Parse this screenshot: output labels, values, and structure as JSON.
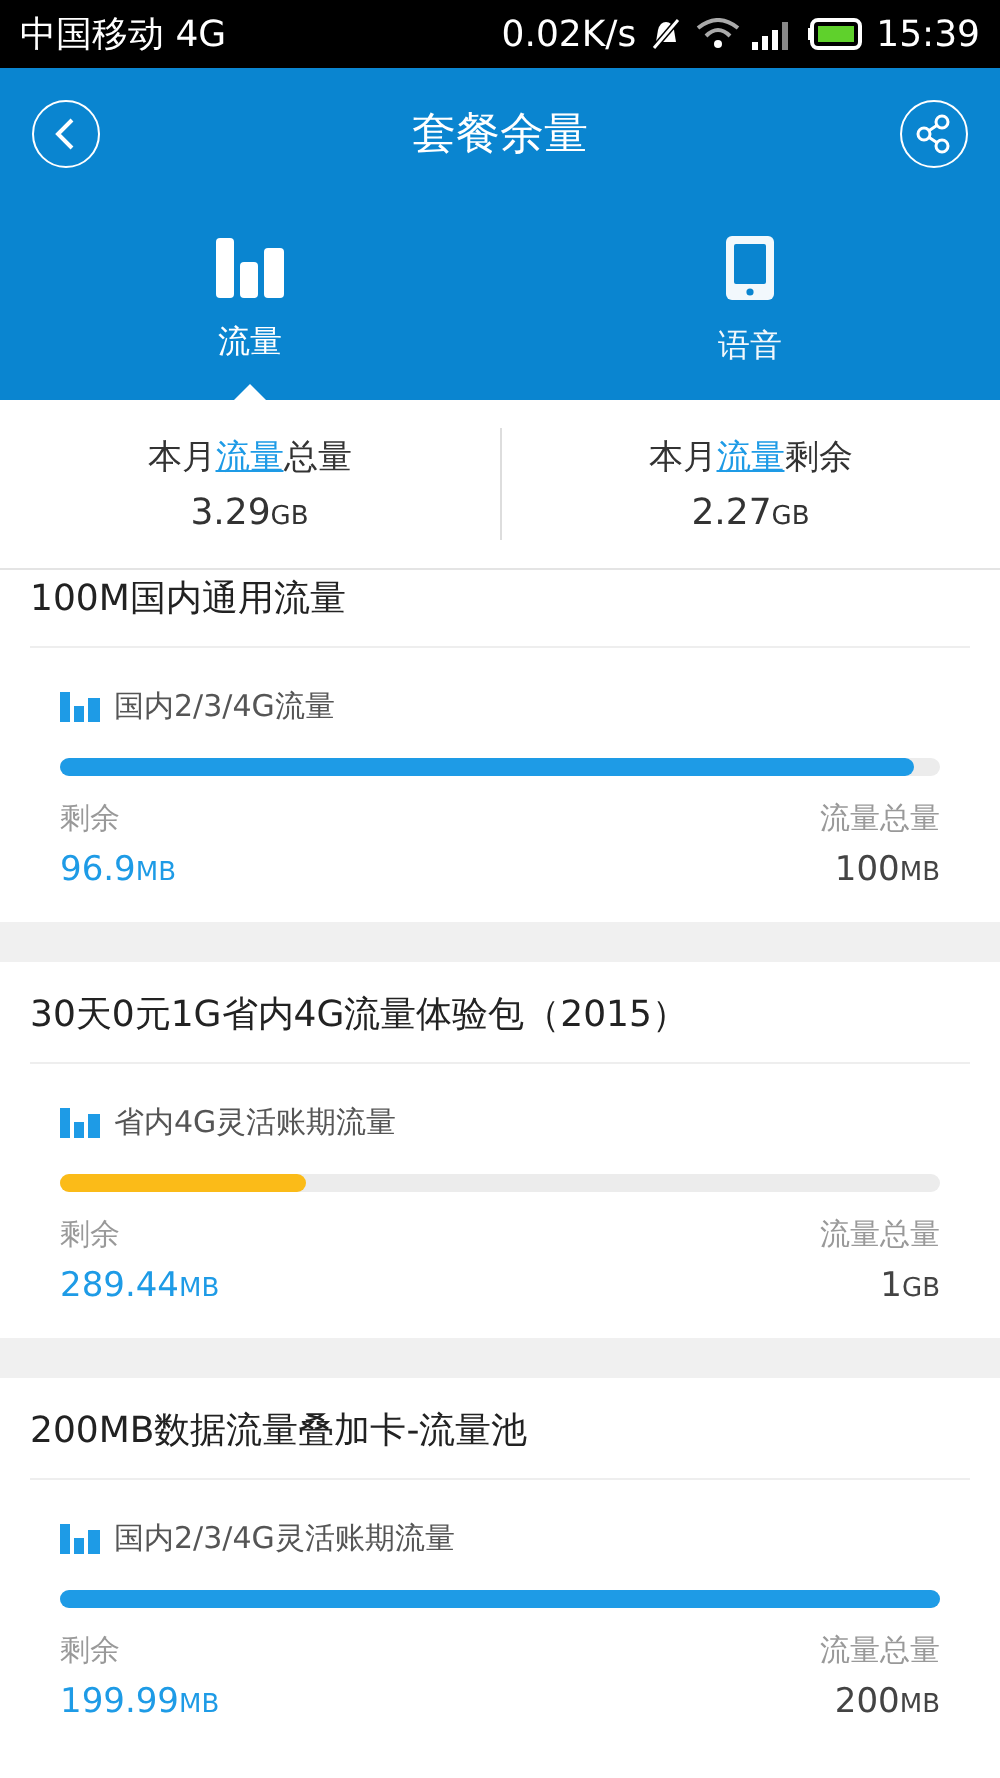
{
  "status_bar": {
    "carrier": "中国移动 4G",
    "speed": "0.02K/s",
    "time": "15:39"
  },
  "header": {
    "title": "套餐余量"
  },
  "tabs": [
    {
      "label": "流量",
      "kind": "data",
      "selected": true
    },
    {
      "label": "语音",
      "kind": "voice",
      "selected": false
    }
  ],
  "summary": [
    {
      "before": "本月",
      "link": "流量",
      "after": "总量",
      "value": "3.29",
      "unit": "GB"
    },
    {
      "before": "本月",
      "link": "流量",
      "after": "剩余",
      "value": "2.27",
      "unit": "GB"
    }
  ],
  "packages": [
    {
      "title": "100M国内通用流量",
      "item": "国内2/3/4G流量",
      "level": 0.97,
      "color": "#1e9be6",
      "remain_label": "剩余",
      "remain_value": "96.9",
      "remain_unit": "MB",
      "total_label": "流量总量",
      "total_value": "100",
      "total_unit": "MB"
    },
    {
      "title": "30天0元1G省内4G流量体验包（2015）",
      "item": "省内4G灵活账期流量",
      "level": 0.28,
      "color": "#fbbb18",
      "remain_label": "剩余",
      "remain_value": "289.44",
      "remain_unit": "MB",
      "total_label": "流量总量",
      "total_value": "1",
      "total_unit": "GB"
    },
    {
      "title": "200MB数据流量叠加卡-流量池",
      "item": "国内2/3/4G灵活账期流量",
      "level": 1.0,
      "color": "#1e9be6",
      "remain_label": "剩余",
      "remain_value": "199.99",
      "remain_unit": "MB",
      "total_label": "流量总量",
      "total_value": "200",
      "total_unit": "MB"
    }
  ]
}
